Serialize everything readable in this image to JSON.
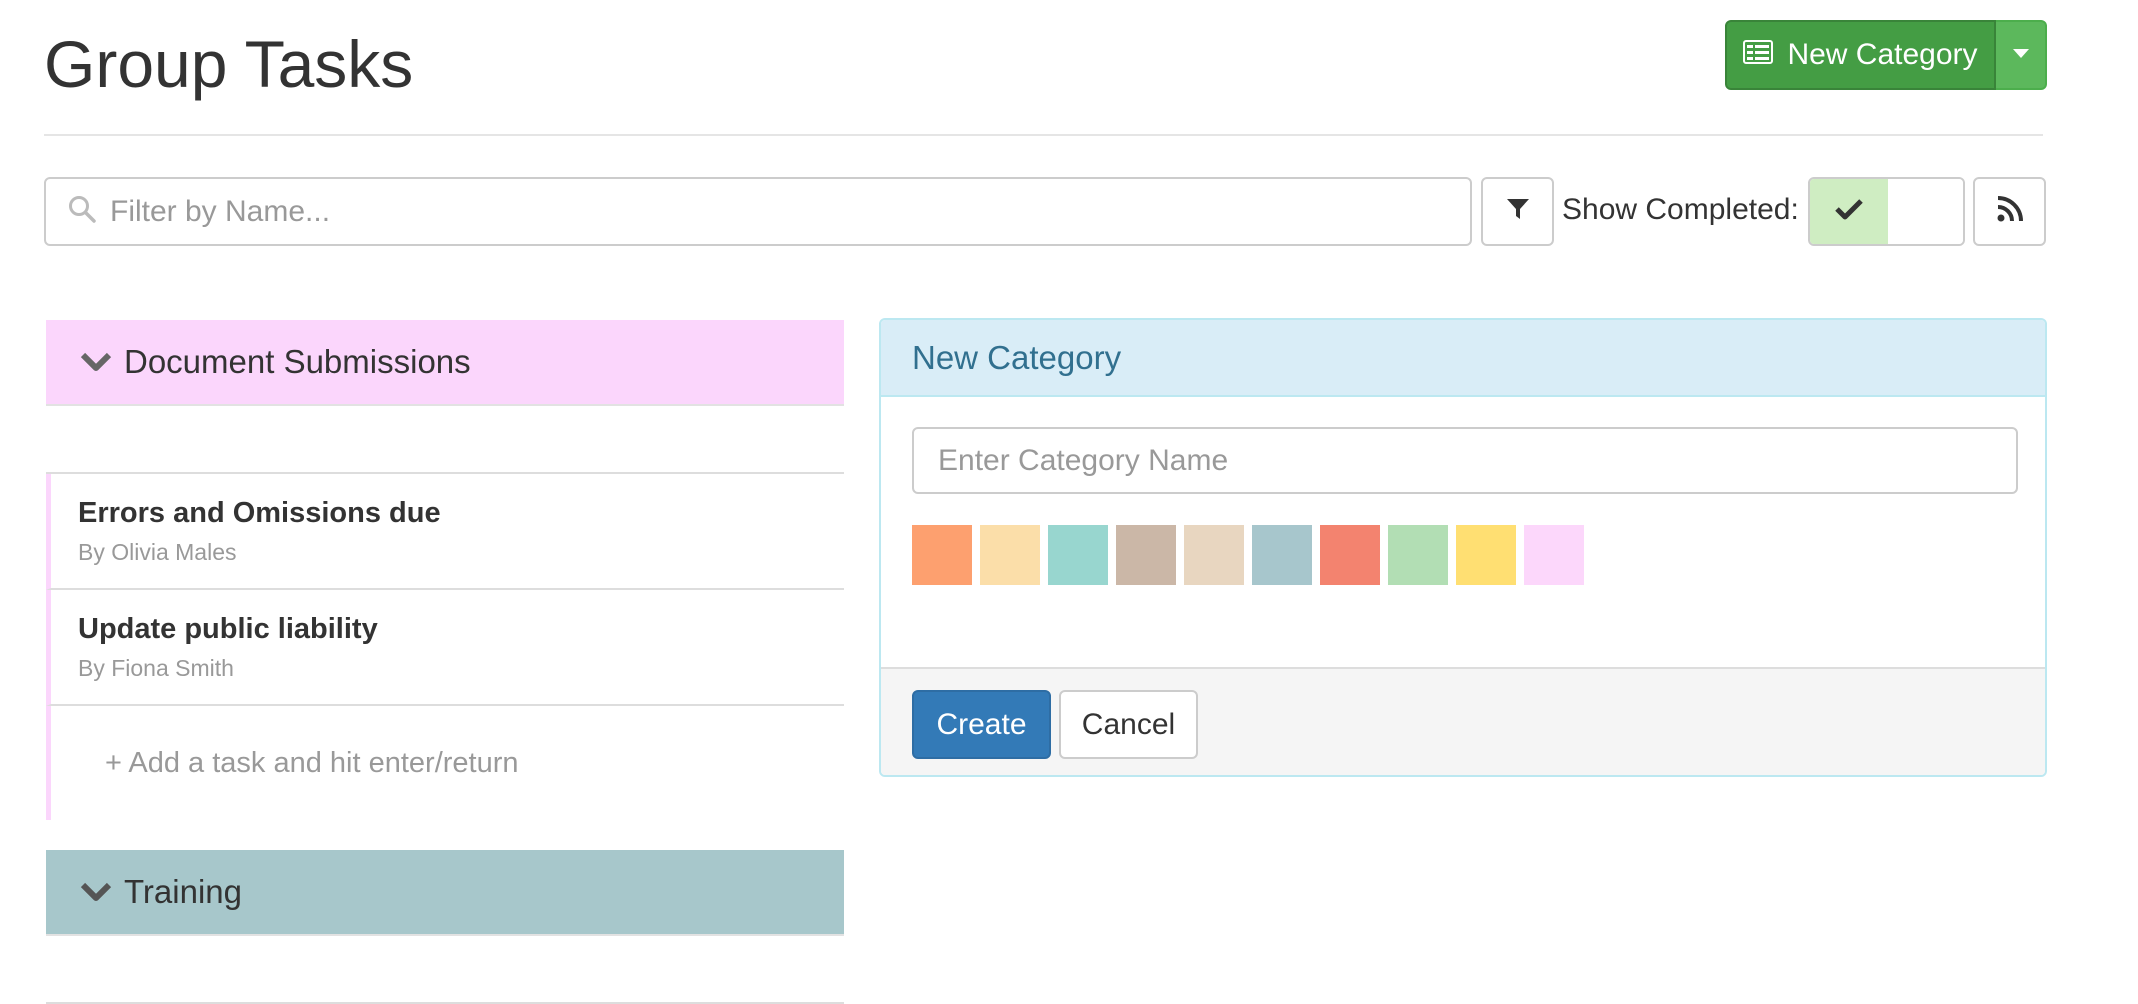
{
  "header": {
    "title": "Group Tasks",
    "new_category_button": "New Category",
    "button_color": "#449d44"
  },
  "filter": {
    "search_placeholder": "Filter by Name...",
    "search_value": "",
    "show_completed_label": "Show Completed:",
    "show_completed": true
  },
  "categories": [
    {
      "name": "Document Submissions",
      "color": "#fbd6fc",
      "tasks": [
        {
          "title": "Errors and Omissions due",
          "author": "By Olivia Males"
        },
        {
          "title": "Update public liability",
          "author": "By Fiona Smith"
        }
      ],
      "add_task_placeholder": "+ Add a task and hit enter/return"
    },
    {
      "name": "Training",
      "color": "#a7c7cb",
      "tasks": []
    }
  ],
  "new_category_panel": {
    "title": "New Category",
    "name_placeholder": "Enter Category Name",
    "name_value": "",
    "swatches": [
      "#fda06f",
      "#fbdea9",
      "#98d6cf",
      "#cbb7a7",
      "#e8d6c0",
      "#a7c6cc",
      "#f3836f",
      "#b2deb4",
      "#ffdf72",
      "#fcd7fb"
    ],
    "create_label": "Create",
    "cancel_label": "Cancel"
  }
}
